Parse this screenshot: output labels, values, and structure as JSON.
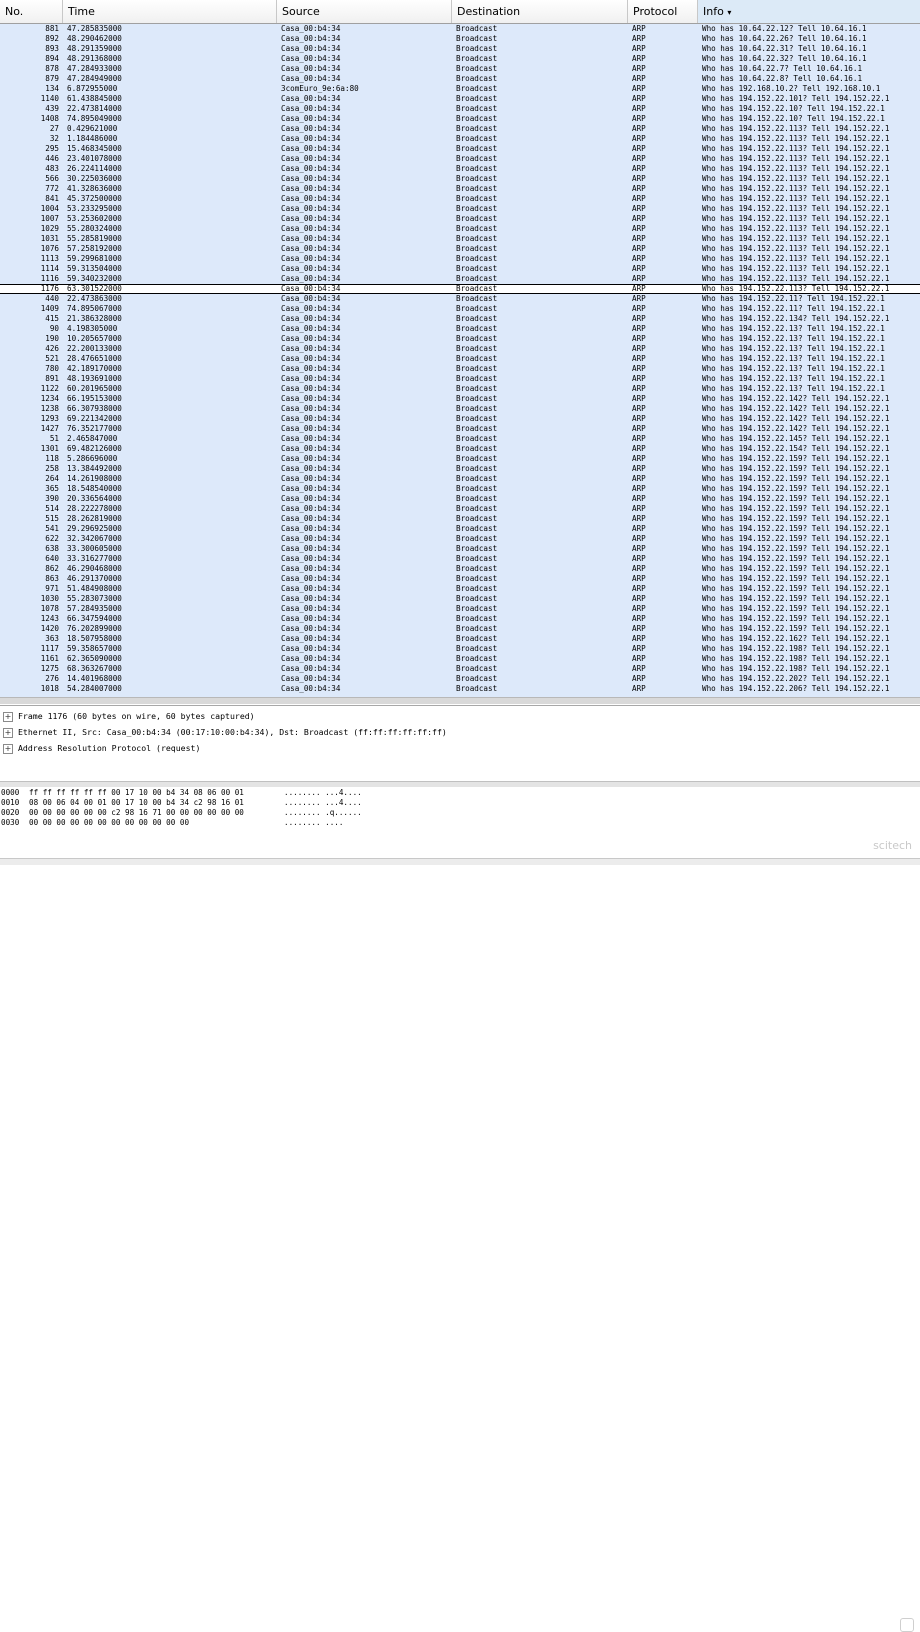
{
  "columns": [
    "No.",
    "Time",
    "Source",
    "Destination",
    "Protocol",
    "Info"
  ],
  "sort_indicator": "▾",
  "packets": [
    [
      "881",
      "47.285835000",
      "Casa_00:b4:34",
      "Broadcast",
      "ARP",
      "Who has 10.64.22.12?  Tell 10.64.16.1"
    ],
    [
      "892",
      "48.290462000",
      "Casa_00:b4:34",
      "Broadcast",
      "ARP",
      "Who has 10.64.22.26?  Tell 10.64.16.1"
    ],
    [
      "893",
      "48.291359000",
      "Casa_00:b4:34",
      "Broadcast",
      "ARP",
      "Who has 10.64.22.31?  Tell 10.64.16.1"
    ],
    [
      "894",
      "48.291368000",
      "Casa_00:b4:34",
      "Broadcast",
      "ARP",
      "Who has 10.64.22.32?  Tell 10.64.16.1"
    ],
    [
      "878",
      "47.284933000",
      "Casa_00:b4:34",
      "Broadcast",
      "ARP",
      "Who has 10.64.22.7?  Tell 10.64.16.1"
    ],
    [
      "879",
      "47.284949000",
      "Casa_00:b4:34",
      "Broadcast",
      "ARP",
      "Who has 10.64.22.8?  Tell 10.64.16.1"
    ],
    [
      "134",
      "6.872955000",
      "3comEuro_9e:6a:80",
      "Broadcast",
      "ARP",
      "Who has 192.168.10.2?  Tell 192.168.10.1"
    ],
    [
      "1140",
      "61.438845000",
      "Casa_00:b4:34",
      "Broadcast",
      "ARP",
      "Who has 194.152.22.101?  Tell 194.152.22.1"
    ],
    [
      "439",
      "22.473814000",
      "Casa_00:b4:34",
      "Broadcast",
      "ARP",
      "Who has 194.152.22.10?  Tell 194.152.22.1"
    ],
    [
      "1408",
      "74.895049000",
      "Casa_00:b4:34",
      "Broadcast",
      "ARP",
      "Who has 194.152.22.10?  Tell 194.152.22.1"
    ],
    [
      "27",
      "0.429621000",
      "Casa_00:b4:34",
      "Broadcast",
      "ARP",
      "Who has 194.152.22.113?  Tell 194.152.22.1"
    ],
    [
      "32",
      "1.184486000",
      "Casa_00:b4:34",
      "Broadcast",
      "ARP",
      "Who has 194.152.22.113?  Tell 194.152.22.1"
    ],
    [
      "295",
      "15.468345000",
      "Casa_00:b4:34",
      "Broadcast",
      "ARP",
      "Who has 194.152.22.113?  Tell 194.152.22.1"
    ],
    [
      "446",
      "23.401078000",
      "Casa_00:b4:34",
      "Broadcast",
      "ARP",
      "Who has 194.152.22.113?  Tell 194.152.22.1"
    ],
    [
      "483",
      "26.224114000",
      "Casa_00:b4:34",
      "Broadcast",
      "ARP",
      "Who has 194.152.22.113?  Tell 194.152.22.1"
    ],
    [
      "566",
      "30.225036000",
      "Casa_00:b4:34",
      "Broadcast",
      "ARP",
      "Who has 194.152.22.113?  Tell 194.152.22.1"
    ],
    [
      "772",
      "41.328636000",
      "Casa_00:b4:34",
      "Broadcast",
      "ARP",
      "Who has 194.152.22.113?  Tell 194.152.22.1"
    ],
    [
      "841",
      "45.372500000",
      "Casa_00:b4:34",
      "Broadcast",
      "ARP",
      "Who has 194.152.22.113?  Tell 194.152.22.1"
    ],
    [
      "1004",
      "53.233295000",
      "Casa_00:b4:34",
      "Broadcast",
      "ARP",
      "Who has 194.152.22.113?  Tell 194.152.22.1"
    ],
    [
      "1007",
      "53.253602000",
      "Casa_00:b4:34",
      "Broadcast",
      "ARP",
      "Who has 194.152.22.113?  Tell 194.152.22.1"
    ],
    [
      "1029",
      "55.280324000",
      "Casa_00:b4:34",
      "Broadcast",
      "ARP",
      "Who has 194.152.22.113?  Tell 194.152.22.1"
    ],
    [
      "1031",
      "55.285819000",
      "Casa_00:b4:34",
      "Broadcast",
      "ARP",
      "Who has 194.152.22.113?  Tell 194.152.22.1"
    ],
    [
      "1076",
      "57.258192000",
      "Casa_00:b4:34",
      "Broadcast",
      "ARP",
      "Who has 194.152.22.113?  Tell 194.152.22.1"
    ],
    [
      "1113",
      "59.299681000",
      "Casa_00:b4:34",
      "Broadcast",
      "ARP",
      "Who has 194.152.22.113?  Tell 194.152.22.1"
    ],
    [
      "1114",
      "59.313504000",
      "Casa_00:b4:34",
      "Broadcast",
      "ARP",
      "Who has 194.152.22.113?  Tell 194.152.22.1"
    ],
    [
      "1116",
      "59.340232000",
      "Casa_00:b4:34",
      "Broadcast",
      "ARP",
      "Who has 194.152.22.113?  Tell 194.152.22.1"
    ],
    [
      "1176",
      "63.301522000",
      "Casa_00:b4:34",
      "Broadcast",
      "ARP",
      "Who has 194.152.22.113?  Tell 194.152.22.1"
    ],
    [
      "440",
      "22.473863000",
      "Casa_00:b4:34",
      "Broadcast",
      "ARP",
      "Who has 194.152.22.11?  Tell 194.152.22.1"
    ],
    [
      "1409",
      "74.895067000",
      "Casa_00:b4:34",
      "Broadcast",
      "ARP",
      "Who has 194.152.22.11?  Tell 194.152.22.1"
    ],
    [
      "415",
      "21.386328000",
      "Casa_00:b4:34",
      "Broadcast",
      "ARP",
      "Who has 194.152.22.134?  Tell 194.152.22.1"
    ],
    [
      "90",
      "4.198305000",
      "Casa_00:b4:34",
      "Broadcast",
      "ARP",
      "Who has 194.152.22.13?  Tell 194.152.22.1"
    ],
    [
      "190",
      "10.205657000",
      "Casa_00:b4:34",
      "Broadcast",
      "ARP",
      "Who has 194.152.22.13?  Tell 194.152.22.1"
    ],
    [
      "426",
      "22.200133000",
      "Casa_00:b4:34",
      "Broadcast",
      "ARP",
      "Who has 194.152.22.13?  Tell 194.152.22.1"
    ],
    [
      "521",
      "28.476651000",
      "Casa_00:b4:34",
      "Broadcast",
      "ARP",
      "Who has 194.152.22.13?  Tell 194.152.22.1"
    ],
    [
      "780",
      "42.189170000",
      "Casa_00:b4:34",
      "Broadcast",
      "ARP",
      "Who has 194.152.22.13?  Tell 194.152.22.1"
    ],
    [
      "891",
      "48.193691000",
      "Casa_00:b4:34",
      "Broadcast",
      "ARP",
      "Who has 194.152.22.13?  Tell 194.152.22.1"
    ],
    [
      "1122",
      "60.201965000",
      "Casa_00:b4:34",
      "Broadcast",
      "ARP",
      "Who has 194.152.22.13?  Tell 194.152.22.1"
    ],
    [
      "1234",
      "66.195153000",
      "Casa_00:b4:34",
      "Broadcast",
      "ARP",
      "Who has 194.152.22.142?  Tell 194.152.22.1"
    ],
    [
      "1238",
      "66.307938000",
      "Casa_00:b4:34",
      "Broadcast",
      "ARP",
      "Who has 194.152.22.142?  Tell 194.152.22.1"
    ],
    [
      "1293",
      "69.221342000",
      "Casa_00:b4:34",
      "Broadcast",
      "ARP",
      "Who has 194.152.22.142?  Tell 194.152.22.1"
    ],
    [
      "1427",
      "76.352177000",
      "Casa_00:b4:34",
      "Broadcast",
      "ARP",
      "Who has 194.152.22.142?  Tell 194.152.22.1"
    ],
    [
      "51",
      "2.465847000",
      "Casa_00:b4:34",
      "Broadcast",
      "ARP",
      "Who has 194.152.22.145?  Tell 194.152.22.1"
    ],
    [
      "1301",
      "69.482126000",
      "Casa_00:b4:34",
      "Broadcast",
      "ARP",
      "Who has 194.152.22.154?  Tell 194.152.22.1"
    ],
    [
      "118",
      "5.286696000",
      "Casa_00:b4:34",
      "Broadcast",
      "ARP",
      "Who has 194.152.22.159?  Tell 194.152.22.1"
    ],
    [
      "258",
      "13.384492000",
      "Casa_00:b4:34",
      "Broadcast",
      "ARP",
      "Who has 194.152.22.159?  Tell 194.152.22.1"
    ],
    [
      "264",
      "14.261908000",
      "Casa_00:b4:34",
      "Broadcast",
      "ARP",
      "Who has 194.152.22.159?  Tell 194.152.22.1"
    ],
    [
      "365",
      "18.548540000",
      "Casa_00:b4:34",
      "Broadcast",
      "ARP",
      "Who has 194.152.22.159?  Tell 194.152.22.1"
    ],
    [
      "390",
      "20.336564000",
      "Casa_00:b4:34",
      "Broadcast",
      "ARP",
      "Who has 194.152.22.159?  Tell 194.152.22.1"
    ],
    [
      "514",
      "28.222278000",
      "Casa_00:b4:34",
      "Broadcast",
      "ARP",
      "Who has 194.152.22.159?  Tell 194.152.22.1"
    ],
    [
      "515",
      "28.262819000",
      "Casa_00:b4:34",
      "Broadcast",
      "ARP",
      "Who has 194.152.22.159?  Tell 194.152.22.1"
    ],
    [
      "541",
      "29.296925000",
      "Casa_00:b4:34",
      "Broadcast",
      "ARP",
      "Who has 194.152.22.159?  Tell 194.152.22.1"
    ],
    [
      "622",
      "32.342067000",
      "Casa_00:b4:34",
      "Broadcast",
      "ARP",
      "Who has 194.152.22.159?  Tell 194.152.22.1"
    ],
    [
      "638",
      "33.300605000",
      "Casa_00:b4:34",
      "Broadcast",
      "ARP",
      "Who has 194.152.22.159?  Tell 194.152.22.1"
    ],
    [
      "640",
      "33.316277000",
      "Casa_00:b4:34",
      "Broadcast",
      "ARP",
      "Who has 194.152.22.159?  Tell 194.152.22.1"
    ],
    [
      "862",
      "46.290468000",
      "Casa_00:b4:34",
      "Broadcast",
      "ARP",
      "Who has 194.152.22.159?  Tell 194.152.22.1"
    ],
    [
      "863",
      "46.291370000",
      "Casa_00:b4:34",
      "Broadcast",
      "ARP",
      "Who has 194.152.22.159?  Tell 194.152.22.1"
    ],
    [
      "971",
      "51.484908000",
      "Casa_00:b4:34",
      "Broadcast",
      "ARP",
      "Who has 194.152.22.159?  Tell 194.152.22.1"
    ],
    [
      "1030",
      "55.283073000",
      "Casa_00:b4:34",
      "Broadcast",
      "ARP",
      "Who has 194.152.22.159?  Tell 194.152.22.1"
    ],
    [
      "1078",
      "57.284935000",
      "Casa_00:b4:34",
      "Broadcast",
      "ARP",
      "Who has 194.152.22.159?  Tell 194.152.22.1"
    ],
    [
      "1243",
      "66.347594000",
      "Casa_00:b4:34",
      "Broadcast",
      "ARP",
      "Who has 194.152.22.159?  Tell 194.152.22.1"
    ],
    [
      "1420",
      "76.202899000",
      "Casa_00:b4:34",
      "Broadcast",
      "ARP",
      "Who has 194.152.22.159?  Tell 194.152.22.1"
    ],
    [
      "363",
      "18.507958000",
      "Casa_00:b4:34",
      "Broadcast",
      "ARP",
      "Who has 194.152.22.162?  Tell 194.152.22.1"
    ],
    [
      "1117",
      "59.358657000",
      "Casa_00:b4:34",
      "Broadcast",
      "ARP",
      "Who has 194.152.22.198?  Tell 194.152.22.1"
    ],
    [
      "1161",
      "62.365090000",
      "Casa_00:b4:34",
      "Broadcast",
      "ARP",
      "Who has 194.152.22.198?  Tell 194.152.22.1"
    ],
    [
      "1275",
      "68.363267000",
      "Casa_00:b4:34",
      "Broadcast",
      "ARP",
      "Who has 194.152.22.198?  Tell 194.152.22.1"
    ],
    [
      "276",
      "14.401968000",
      "Casa_00:b4:34",
      "Broadcast",
      "ARP",
      "Who has 194.152.22.202?  Tell 194.152.22.1"
    ],
    [
      "1018",
      "54.284007000",
      "Casa_00:b4:34",
      "Broadcast",
      "ARP",
      "Who has 194.152.22.206?  Tell 194.152.22.1"
    ]
  ],
  "selected_packet": "1176",
  "details": [
    "Frame 1176 (60 bytes on wire, 60 bytes captured)",
    "Ethernet II, Src: Casa_00:b4:34 (00:17:10:00:b4:34), Dst: Broadcast (ff:ff:ff:ff:ff:ff)",
    "Address Resolution Protocol (request)"
  ],
  "expander_glyph": "+",
  "hex": [
    {
      "offset": "0000",
      "bytes": "ff ff ff ff ff ff 00 17  10 00 b4 34 08 06 00 01",
      "ascii": "........ ...4...."
    },
    {
      "offset": "0010",
      "bytes": "08 00 06 04 00 01 00 17  10 00 b4 34 c2 98 16 01",
      "ascii": "........ ...4...."
    },
    {
      "offset": "0020",
      "bytes": "00 00 00 00 00 00 c2 98  16 71 00 00 00 00 00 00",
      "ascii": "........ .q......"
    },
    {
      "offset": "0030",
      "bytes": "00 00 00 00 00 00 00 00  00 00 00 00",
      "ascii": "........ ...."
    }
  ],
  "watermark": "scitech"
}
